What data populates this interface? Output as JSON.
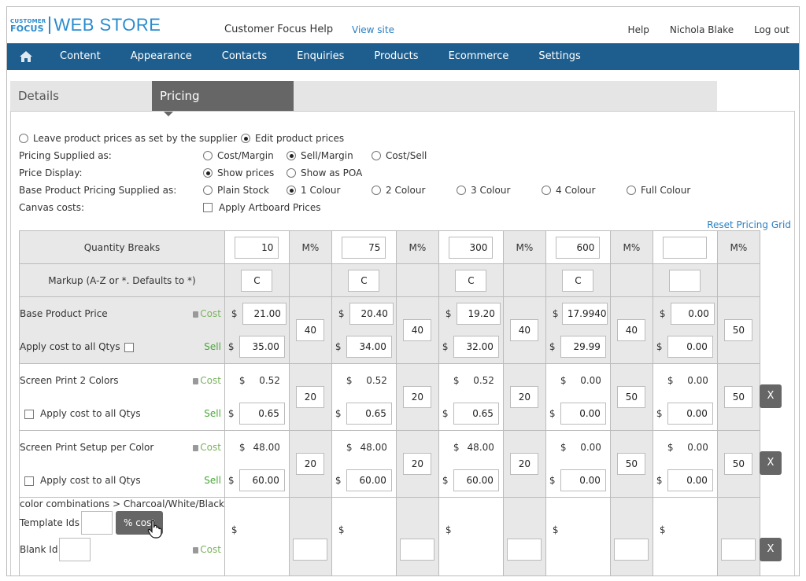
{
  "header": {
    "logo_small_line1": "CUSTOMER",
    "logo_small_line2": "FOCUS",
    "logo_big": "WEB STORE",
    "help_title": "Customer Focus Help",
    "view_site": "View site",
    "help": "Help",
    "user": "Nichola Blake",
    "logout": "Log out"
  },
  "nav": {
    "home_icon": "home-icon",
    "items": [
      "Content",
      "Appearance",
      "Contacts",
      "Enquiries",
      "Products",
      "Ecommerce",
      "Settings"
    ]
  },
  "tabs": {
    "details": "Details",
    "pricing": "Pricing"
  },
  "options": {
    "leave_prices": "Leave product prices as set by the supplier",
    "edit_prices": "Edit product prices",
    "pricing_supplied_label": "Pricing Supplied as:",
    "pricing_supplied": [
      "Cost/Margin",
      "Sell/Margin",
      "Cost/Sell"
    ],
    "price_display_label": "Price Display:",
    "price_display": [
      "Show prices",
      "Show as POA"
    ],
    "base_pricing_label": "Base Product Pricing Supplied as:",
    "base_pricing": [
      "Plain Stock",
      "1 Colour",
      "2 Colour",
      "3 Colour",
      "4 Colour",
      "Full Colour"
    ],
    "canvas_label": "Canvas costs:",
    "artboard": "Apply Artboard Prices",
    "reset": "Reset Pricing Grid"
  },
  "grid": {
    "qty_label": "Quantity Breaks",
    "markup_label": "Markup (A-Z or *. Defaults to *)",
    "m_pct": "M%",
    "qty": [
      "10",
      "75",
      "300",
      "600",
      ""
    ],
    "markup": [
      "C",
      "C",
      "C",
      "C",
      ""
    ],
    "cost_label": "Cost",
    "sell_label": "Sell",
    "currency": "$",
    "base": {
      "label": "Base Product Price",
      "apply": "Apply cost to all Qtys",
      "cost": [
        "21.00",
        "20.40",
        "19.20",
        "17.9940",
        "0.00"
      ],
      "sell": [
        "35.00",
        "34.00",
        "32.00",
        "29.99",
        "0.00"
      ],
      "margin": [
        "40",
        "40",
        "40",
        "40",
        "50"
      ]
    },
    "screen2": {
      "label": "Screen Print 2 Colors",
      "apply": "Apply cost to all Qtys",
      "cost": [
        "0.52",
        "0.52",
        "0.52",
        "0.00",
        "0.00"
      ],
      "sell": [
        "0.65",
        "0.65",
        "0.65",
        "0.00",
        "0.00"
      ],
      "margin": [
        "20",
        "20",
        "20",
        "50",
        "50"
      ]
    },
    "setup": {
      "label": "Screen Print Setup per Color",
      "apply": "Apply cost to all Qtys",
      "cost": [
        "48.00",
        "48.00",
        "48.00",
        "0.00",
        "0.00"
      ],
      "sell": [
        "60.00",
        "60.00",
        "60.00",
        "0.00",
        "0.00"
      ],
      "margin": [
        "20",
        "20",
        "20",
        "50",
        "50"
      ]
    },
    "combo": {
      "label": "color combinations > Charcoal/White/Black",
      "template_ids": "Template Ids",
      "pct_cost": "% cost",
      "blank_id": "Blank Id"
    },
    "remove": "X"
  }
}
